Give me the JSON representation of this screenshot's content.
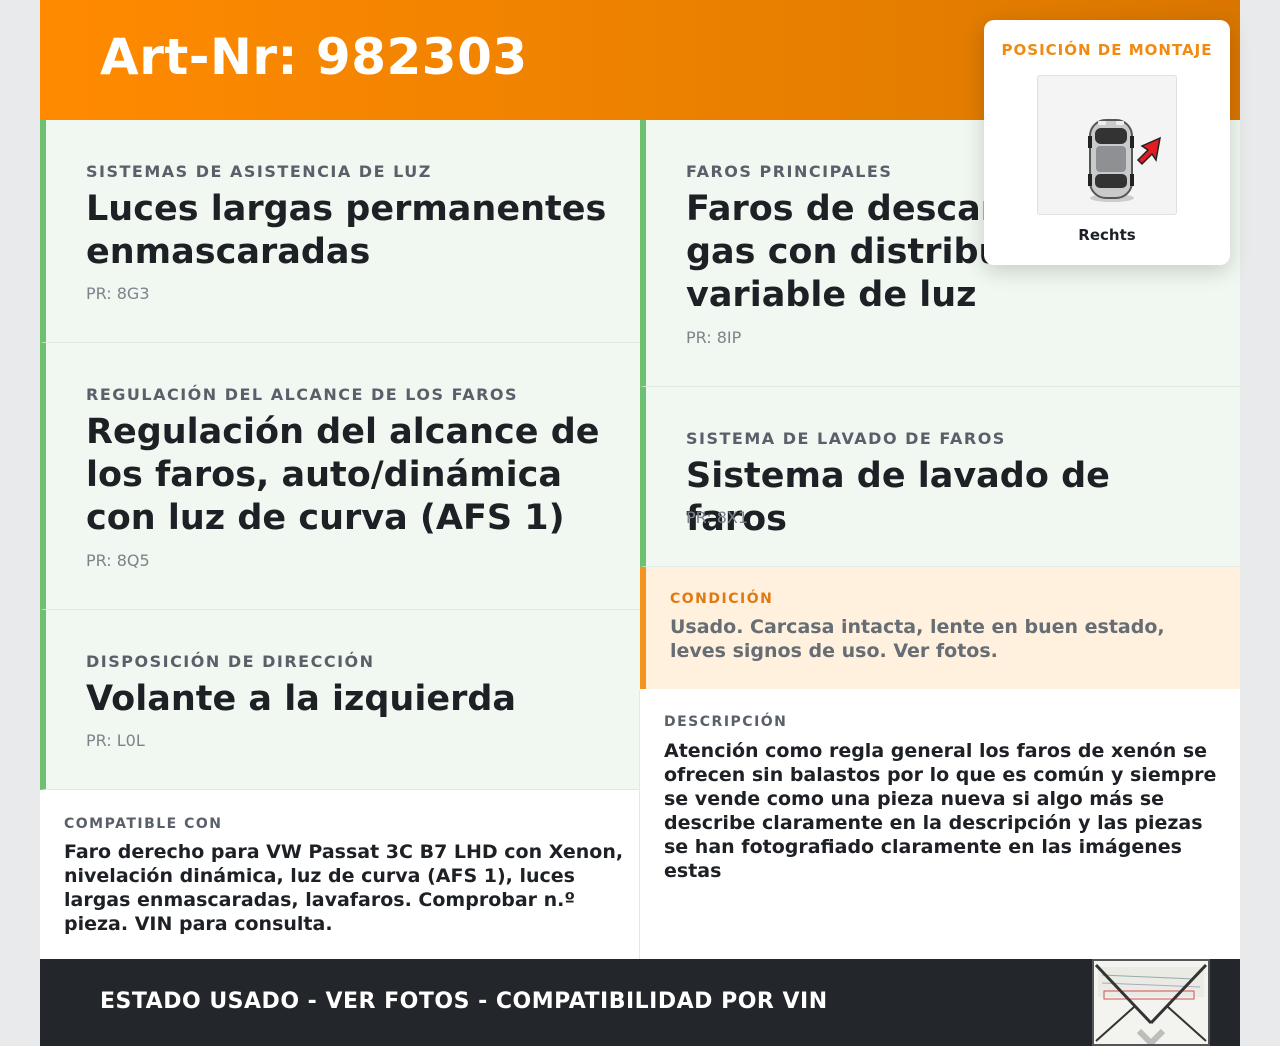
{
  "header": {
    "title": "Art-Nr: 982303"
  },
  "features_left": [
    {
      "category": "SISTEMAS DE ASISTENCIA DE LUZ",
      "title": "Luces largas permanentes enmascaradas",
      "pr": "PR: 8G3"
    },
    {
      "category": "REGULACIÓN DEL ALCANCE DE LOS FAROS",
      "title": "Regulación del alcance de los faros, auto/dinámica con luz de curva (AFS 1)",
      "pr": "PR: 8Q5"
    },
    {
      "category": "DISPOSICIÓN DE DIRECCIÓN",
      "title": "Volante a la izquierda",
      "pr": "PR: L0L"
    }
  ],
  "features_right": [
    {
      "category": "FAROS PRINCIPALES",
      "title": "Faros de descarga de gas con distribución variable de luz",
      "pr": "PR: 8IP"
    },
    {
      "category": "SISTEMA DE LAVADO DE FAROS",
      "title": "Sistema de lavado de faros",
      "pr": "PR: 8X1"
    }
  ],
  "condition": {
    "label": "CONDICIÓN",
    "text": "Usado. Carcasa intacta, lente en buen estado, leves signos de uso. Ver fotos."
  },
  "compatible": {
    "label": "COMPATIBLE CON",
    "text": "Faro derecho para VW Passat 3C B7 LHD con Xenon, nivelación dinámica, luz de curva (AFS 1), luces largas enmascaradas, lavafaros. Comprobar n.º pieza. VIN para consulta."
  },
  "description": {
    "label": "DESCRIPCIÓN",
    "text": "Atención como regla general los faros de xenón se ofrecen sin balastos por lo que es común y siempre se vende como una pieza nueva si algo más se describe claramente en la descripción y las piezas se han fotografiado claramente en las imágenes estas"
  },
  "footer": {
    "text": "ESTADO USADO - VER FOTOS - COMPATIBILIDAD POR VIN"
  },
  "popover": {
    "title": "POSICIÓN DE MONTAJE",
    "label": "Rechts",
    "icon": "car-top-view-icon",
    "arrow_color": "#e31b23"
  },
  "colors": {
    "accent": "#ff8a00",
    "feature_border": "#6cc070",
    "condition_border": "#f2941d",
    "footer_bg": "#23262b"
  }
}
